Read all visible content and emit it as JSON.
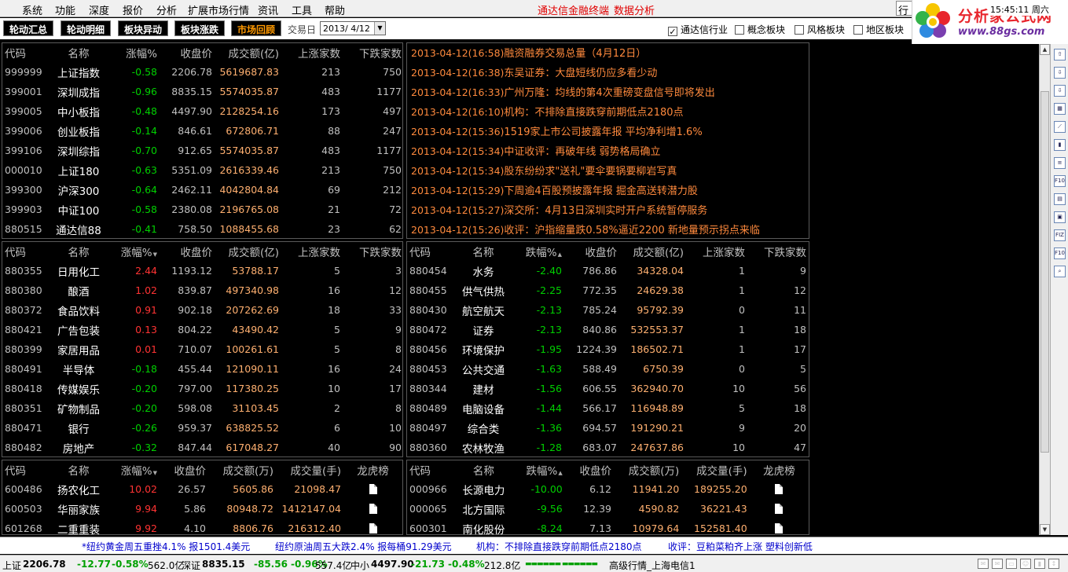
{
  "menu": [
    "系统",
    "功能",
    "深度",
    "报价",
    "分析",
    "扩展市场行情",
    "资讯",
    "工具",
    "帮助"
  ],
  "brand": {
    "terminal": "通达信金融终端",
    "analysis": "数据分析"
  },
  "clock": "15:45:11 周六",
  "clock_extra": "行",
  "logo": {
    "cn": "分析家公式网",
    "url": "www.88gs.com"
  },
  "tabs": [
    {
      "label": "轮动汇总",
      "active": false
    },
    {
      "label": "轮动明细",
      "active": false
    },
    {
      "label": "板块异动",
      "active": false
    },
    {
      "label": "板块涨跌",
      "active": false
    },
    {
      "label": "市场回顾",
      "active": true
    }
  ],
  "trade_date": {
    "label": "交易日",
    "value": "2013/ 4/12"
  },
  "filters": [
    {
      "label": "通达信行业",
      "checked": true
    },
    {
      "label": "概念板块",
      "checked": false
    },
    {
      "label": "风格板块",
      "checked": false
    },
    {
      "label": "地区板块",
      "checked": false
    }
  ],
  "index_table": {
    "headers": [
      "代码",
      "名称",
      "涨幅%",
      "收盘价",
      "成交额(亿)",
      "上涨家数",
      "下跌家数"
    ],
    "rows": [
      [
        "999999",
        "上证指数",
        "-0.58",
        "2206.78",
        "5619687.83",
        "213",
        "750"
      ],
      [
        "399001",
        "深圳成指",
        "-0.96",
        "8835.15",
        "5574035.87",
        "483",
        "1177"
      ],
      [
        "399005",
        "中小板指",
        "-0.48",
        "4497.90",
        "2128254.16",
        "173",
        "497"
      ],
      [
        "399006",
        "创业板指",
        "-0.14",
        "846.61",
        "672806.71",
        "88",
        "247"
      ],
      [
        "399106",
        "深圳综指",
        "-0.70",
        "912.65",
        "5574035.87",
        "483",
        "1177"
      ],
      [
        "000010",
        "上证180",
        "-0.63",
        "5351.09",
        "2616339.46",
        "213",
        "750"
      ],
      [
        "399300",
        "沪深300",
        "-0.64",
        "2462.11",
        "4042804.84",
        "69",
        "212"
      ],
      [
        "399903",
        "中证100",
        "-0.58",
        "2380.08",
        "2196765.08",
        "21",
        "72"
      ],
      [
        "880515",
        "通达信88",
        "-0.41",
        "758.50",
        "1088455.68",
        "23",
        "62"
      ]
    ]
  },
  "news": [
    {
      "time": "2013-04-12(16:58)",
      "text": "融资融券交易总量（4月12日）"
    },
    {
      "time": "2013-04-12(16:38)",
      "text": "东吴证券：大盘短线仍应多看少动"
    },
    {
      "time": "2013-04-12(16:33)",
      "text": "广州万隆：均线的第4次重磅变盘信号即将发出"
    },
    {
      "time": "2013-04-12(16:10)",
      "text": "机构：不排除直接跌穿前期低点2180点"
    },
    {
      "time": "2013-04-12(15:36)",
      "text": "1519家上市公司披露年报 平均净利增1.6%"
    },
    {
      "time": "2013-04-12(15:34)",
      "text": "中证收评：再破年线 弱势格局确立"
    },
    {
      "time": "2013-04-12(15:34)",
      "text": "股东纷纷求\"送礼\"要伞要锅要柳岩写真"
    },
    {
      "time": "2013-04-12(15:29)",
      "text": "下周逾4百股预披露年报 掘金高送转潜力股"
    },
    {
      "time": "2013-04-12(15:27)",
      "text": "深交所：4月13日深圳实时开户系统暂停服务"
    },
    {
      "time": "2013-04-12(15:26)",
      "text": "收评：沪指缩量跌0.58%逼近2200 新地量预示拐点来临"
    }
  ],
  "sector_gain": {
    "headers": [
      "代码",
      "名称",
      "涨幅%",
      "收盘价",
      "成交额(亿)",
      "上涨家数",
      "下跌家数"
    ],
    "sort_mark": "▼",
    "rows": [
      [
        "880355",
        "日用化工",
        "2.44",
        "1193.12",
        "53788.17",
        "5",
        "3"
      ],
      [
        "880380",
        "酿酒",
        "1.02",
        "839.87",
        "497340.98",
        "16",
        "12"
      ],
      [
        "880372",
        "食品饮料",
        "0.91",
        "902.18",
        "207262.69",
        "18",
        "33"
      ],
      [
        "880421",
        "广告包装",
        "0.13",
        "804.22",
        "43490.42",
        "5",
        "9"
      ],
      [
        "880399",
        "家居用品",
        "0.01",
        "710.07",
        "100261.61",
        "5",
        "8"
      ],
      [
        "880491",
        "半导体",
        "-0.18",
        "455.44",
        "121090.11",
        "16",
        "24"
      ],
      [
        "880418",
        "传媒娱乐",
        "-0.20",
        "797.00",
        "117380.25",
        "10",
        "17"
      ],
      [
        "880351",
        "矿物制品",
        "-0.20",
        "598.08",
        "31103.45",
        "2",
        "8"
      ],
      [
        "880471",
        "银行",
        "-0.26",
        "959.37",
        "638825.52",
        "6",
        "10"
      ],
      [
        "880482",
        "房地产",
        "-0.32",
        "847.44",
        "617048.27",
        "40",
        "90"
      ]
    ]
  },
  "sector_loss": {
    "headers": [
      "代码",
      "名称",
      "跌幅%",
      "收盘价",
      "成交额(亿)",
      "上涨家数",
      "下跌家数"
    ],
    "sort_mark": "▲",
    "rows": [
      [
        "880454",
        "水务",
        "-2.40",
        "786.86",
        "34328.04",
        "1",
        "9"
      ],
      [
        "880455",
        "供气供热",
        "-2.25",
        "772.35",
        "24629.38",
        "1",
        "12"
      ],
      [
        "880430",
        "航空航天",
        "-2.13",
        "785.24",
        "95792.39",
        "0",
        "11"
      ],
      [
        "880472",
        "证券",
        "-2.13",
        "840.86",
        "532553.37",
        "1",
        "18"
      ],
      [
        "880456",
        "环境保护",
        "-1.95",
        "1224.39",
        "186502.71",
        "1",
        "17"
      ],
      [
        "880453",
        "公共交通",
        "-1.63",
        "588.49",
        "6750.39",
        "0",
        "5"
      ],
      [
        "880344",
        "建材",
        "-1.56",
        "606.55",
        "362940.70",
        "10",
        "56"
      ],
      [
        "880489",
        "电脑设备",
        "-1.44",
        "566.17",
        "116948.89",
        "5",
        "18"
      ],
      [
        "880497",
        "综合类",
        "-1.36",
        "694.57",
        "191290.21",
        "9",
        "20"
      ],
      [
        "880360",
        "农林牧渔",
        "-1.28",
        "683.07",
        "247637.86",
        "10",
        "47"
      ]
    ]
  },
  "stock_gain": {
    "headers": [
      "代码",
      "名称",
      "涨幅%",
      "收盘价",
      "成交额(万)",
      "成交量(手)",
      "龙虎榜"
    ],
    "sort_mark": "▼",
    "rows": [
      [
        "600486",
        "扬农化工",
        "10.02",
        "26.57",
        "5605.86",
        "21098.47"
      ],
      [
        "600503",
        "华丽家族",
        "9.94",
        "5.86",
        "80948.72",
        "1412147.04"
      ],
      [
        "601268",
        "二重重装",
        "9.92",
        "4.10",
        "8806.76",
        "216312.40"
      ]
    ]
  },
  "stock_loss": {
    "headers": [
      "代码",
      "名称",
      "跌幅%",
      "收盘价",
      "成交额(万)",
      "成交量(手)",
      "龙虎榜"
    ],
    "sort_mark": "▲",
    "rows": [
      [
        "000966",
        "长源电力",
        "-10.00",
        "6.12",
        "11941.20",
        "189255.20"
      ],
      [
        "000065",
        "北方国际",
        "-9.56",
        "12.39",
        "4590.82",
        "36221.43"
      ],
      [
        "600301",
        "南化股份",
        "-8.24",
        "7.13",
        "10979.64",
        "152581.40"
      ]
    ]
  },
  "ticker": [
    "*纽约黄金周五重挫4.1% 报1501.4美元",
    "纽约原油周五大跌2.4% 报每桶91.29美元",
    "机构：不排除直接跌穿前期低点2180点",
    "收评：豆粕菜粕齐上涨 塑料创新低"
  ],
  "status": {
    "sh_label": "上证",
    "sh_val": "2206.78",
    "sh_chg": "-12.77",
    "sh_pct": "-0.58%",
    "sh_amt": "562.0亿",
    "sz_label": "深证",
    "sz_val": "8835.15",
    "sz_chg": "-85.56",
    "sz_pct": "-0.96%",
    "sz_amt": "557.4亿",
    "zx_label": "中小",
    "zx_val": "4497.90",
    "zx_chg": "-21.73",
    "zx_pct": "-0.48%",
    "zx_amt": "212.8亿",
    "server": "高级行情_上海电信1"
  },
  "colors": {
    "up": "#ff3333",
    "down": "#00d000",
    "amount": "#ffb070",
    "news": "#ff8a3d",
    "active_tab": "#ff9900"
  },
  "right_icons": [
    "arrow-up-icon",
    "arrow-down-icon",
    "arrow-down-icon",
    "grid-icon",
    "line-chart-icon",
    "candle-icon",
    "stack-icon",
    "f10-icon",
    "doc-icon",
    "calendar-icon",
    "fiz-icon",
    "f10-icon",
    "search-icon"
  ]
}
